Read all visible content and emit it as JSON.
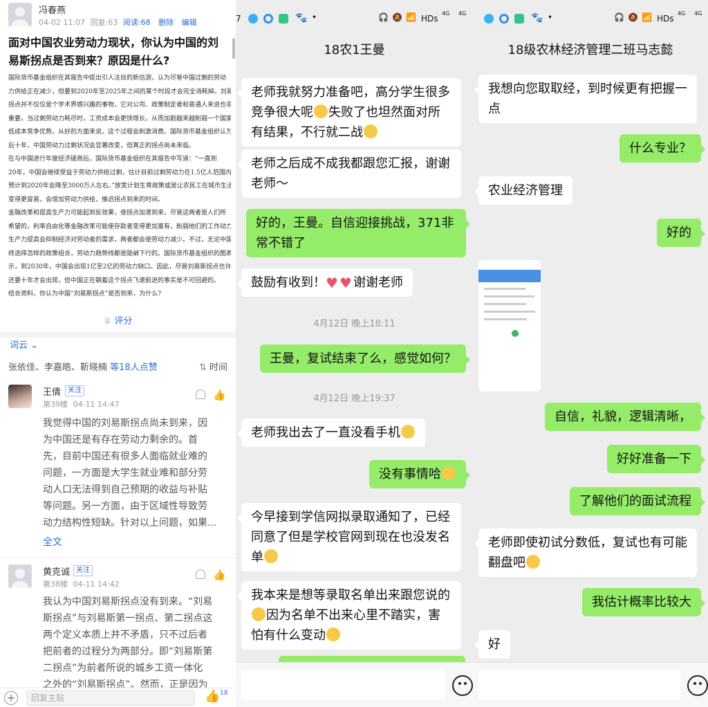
{
  "forum": {
    "post": {
      "author": "冯春燕",
      "date": "04-02 11:07",
      "replies": "回复:63",
      "reads": "阅读:68",
      "delete": "删除",
      "edit": "编辑",
      "title": "面对中国农业劳动力现状，你认为中国的刘易斯拐点是否到来？原因是什么?",
      "body_lines": [
        "国际货币基金组织在其报告中提出引人注目的新估测，认为尽管中国过剩的劳动",
        "力供给正在减少，但要到2020年至2025年之间的某个时段才会完全消耗掉。刘易斯",
        "拐点并不仅仅是个学术界感兴趣的事物，它对公司、政策制定者和普通人来说也非常",
        "重要。当过剩劳动力耗尽时，工资成本会更快增长，从而加剧越来越削弱一个国家的",
        "低成本竞争优势。从好的方面来说，这个过程会刺激消费。国际货币基金组织认为，",
        "后十年，中国劳动力过剩状况会显著改变，但真正的拐点尚未来临。",
        "在与中国进行年度经济磋商后，国际货币基金组织在其报告中写道：“一直到",
        "20年，中国会继续受益于劳动力供给过剩，估计目前过剩劳动力在1.5亿人范围内，",
        "预计到2020年会降至3000万人左右。”放宽计划生育政策或是让农民工在城市生活",
        "变得更容易，会增加劳动力供给，推迟拐点到来的时间。",
        "金融改革和提高生产力可能起到反效果，使拐点加速到来，尽管这两者是人们所",
        "希望的，利率自由化等金融改革可能使存款者变得更加富有，削弱他们的工作动力，",
        "生产力提高会抑制经济对劳动者的需求，两者都会使劳动力减少。不过，无论中国最",
        "终选择怎样的政策组合，劳动力趋势线都是陡峭下行的。国际货币基金组织的图表显",
        "示，到2030年，中国会出现1亿至2亿的劳动力缺口。因此，尽管刘易斯拐点也许",
        "还要十年才会出现，但中国正在朝着这个拐点飞速前进的事实是不可回避的。",
        "结合资料，你认为中国“刘易斯拐点”是否到来，为什么?"
      ],
      "rate": "评分"
    },
    "word_cloud": "词云",
    "likes_users": "张依佳、李嘉皓、靳晓楠",
    "likes_count": "等18人点赞",
    "sort": "时间",
    "comments": [
      {
        "name": "王倩",
        "tag": "关注",
        "floor": "第39楼",
        "date": "04-11 14:47",
        "lines": [
          "我觉得中国的刘易斯拐点尚未到来，因",
          "为中国还是有存在劳动力剩余的。首",
          "先，目前中国还有很多人面临就业难的",
          "问题，一方面是大学生就业难和部分劳",
          "动人口无法得到自己预期的收益与补贴",
          "等问题。另一方面，由于区域性导致劳",
          "动力结构性短缺。针对以上问题，如果..."
        ],
        "more": "全文"
      },
      {
        "name": "黄克诚",
        "tag": "关注",
        "floor": "第38楼",
        "date": "04-11 14:42",
        "lines": [
          "我认为中国刘易斯拐点没有到来。“刘易",
          "斯拐点”与刘易斯第一拐点、第二拐点这",
          "两个定义本质上并不矛盾，只不过后者",
          "把前者的过程分为两部分。即“刘易斯第",
          "二拐点”为前者所说的城乡工资一体化",
          "之外的“刘易斯拐点”。然而，正是因为"
        ]
      }
    ],
    "reply_placeholder": "回复主贴",
    "like_count": "18"
  },
  "status": {
    "net": "HDs",
    "sig1": "4G",
    "sig2": "4G"
  },
  "chat1": {
    "title": "18农1王曼",
    "messages": [
      {
        "side": "left",
        "text": "老师我就努力准备吧，高分学生很多竞争很大呢",
        "emo": true,
        "text2": "失败了也坦然面对所有结果，不行就二战",
        "emo2": true
      },
      {
        "side": "left",
        "text": "老师之后成不成我都跟您汇报，谢谢老师～"
      },
      {
        "side": "right",
        "text": "好的，王曼。自信迎接挑战，371非常不错了"
      },
      {
        "side": "left",
        "text": "鼓励有收到！",
        "hearts": true,
        "text2": "谢谢老师"
      },
      {
        "time": "4月12日 晚上18:11"
      },
      {
        "side": "right",
        "text": "王曼，复试结束了么，感觉如何？"
      },
      {
        "time": "4月12日 晚上19:37"
      },
      {
        "side": "left",
        "text": "老师我出去了一直没看手机",
        "emo": true
      },
      {
        "side": "right",
        "text": "没有事情哈",
        "emo": true
      },
      {
        "side": "left",
        "text": "今早接到学信网拟录取通知了，已经同意了但是学校官网到现在也没发名单",
        "emo": true
      },
      {
        "side": "left",
        "text": "我本来是想等录取名单出来跟您说的",
        "emo": true,
        "text2": "因为名单不出来心里不踏实，害怕有什么变动",
        "emo2": true
      }
    ]
  },
  "chat2": {
    "title": "18级农林经济管理二班马志懿",
    "messages": [
      {
        "side": "left",
        "text": "我想向您取取经，到时候更有把握一点"
      },
      {
        "side": "right",
        "text": "什么专业？"
      },
      {
        "side": "left",
        "text": "农业经济管理"
      },
      {
        "side": "right",
        "text": "好的"
      },
      {
        "side": "left",
        "image": true
      },
      {
        "side": "right",
        "text": "自信，礼貌，逻辑清晰，"
      },
      {
        "side": "right",
        "text": "好好准备一下"
      },
      {
        "side": "right",
        "text": "了解他们的面试流程"
      },
      {
        "side": "left",
        "text": "老师即使初试分数低，复试也有可能翻盘吧",
        "emo": true
      },
      {
        "side": "right",
        "text": "我估计概率比较大"
      },
      {
        "side": "left",
        "text": "好"
      }
    ]
  },
  "colors": {
    "accent": "#2a6fd6",
    "bubble_green": "#95ec69",
    "chat_bg": "#ededed"
  }
}
